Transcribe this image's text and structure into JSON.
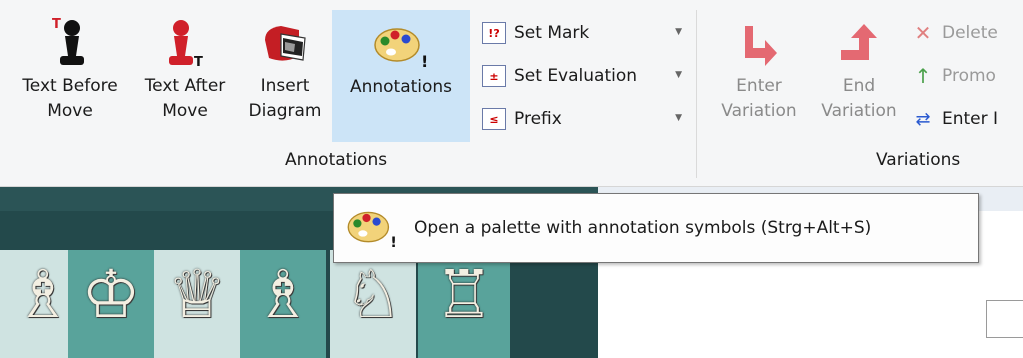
{
  "ribbon": {
    "annotations_group": {
      "label": "Annotations",
      "buttons": [
        {
          "label_line1": "Text Before",
          "label_line2": "Move",
          "icon": "pawn-text-before-icon"
        },
        {
          "label_line1": "Text After",
          "label_line2": "Move",
          "icon": "pawn-text-after-icon"
        },
        {
          "label_line1": "Insert",
          "label_line2": "Diagram",
          "icon": "diagram-icon"
        },
        {
          "label_line1": "Annotations",
          "label_line2": "",
          "icon": "palette-icon"
        }
      ],
      "small_buttons": [
        {
          "label": "Set Mark",
          "icon_text": "!?"
        },
        {
          "label": "Set Evaluation",
          "icon_text": "±"
        },
        {
          "label": "Prefix",
          "icon_text": "≤"
        }
      ]
    },
    "variations_group": {
      "label": "Variations",
      "buttons": [
        {
          "label_line1": "Enter",
          "label_line2": "Variation",
          "icon": "enter-variation-icon"
        },
        {
          "label_line1": "End",
          "label_line2": "Variation",
          "icon": "end-variation-icon"
        }
      ],
      "small_buttons": [
        {
          "label": "Delete",
          "icon": "delete-icon"
        },
        {
          "label": "Promo",
          "icon": "promote-icon"
        },
        {
          "label": "Enter I",
          "icon": "enter-icon"
        }
      ]
    }
  },
  "tooltip": {
    "text": "Open a palette with annotation symbols (Strg+Alt+S)",
    "icon": "palette-icon"
  },
  "board": {
    "pieces": [
      "♗",
      "♔",
      "♕",
      "♗",
      "♘",
      "♖"
    ]
  },
  "colors": {
    "ribbon_bg": "#f5f6f7",
    "active_button": "#cce4f7",
    "board_light": "#cfe3e1",
    "board_dark": "#59a39b",
    "board_frame": "#23494b",
    "variation_red": "#e0505a"
  }
}
